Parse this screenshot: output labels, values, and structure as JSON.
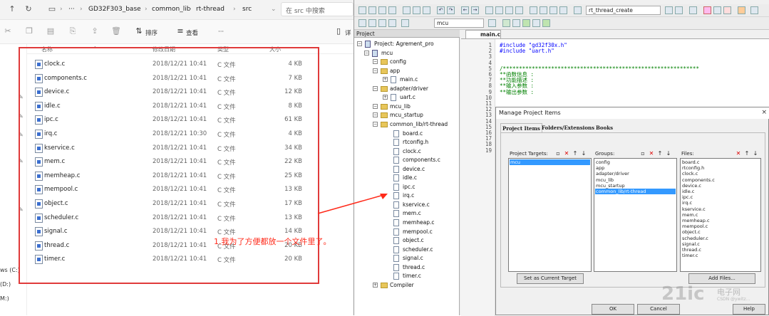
{
  "explorer": {
    "breadcrumbs": [
      "GD32F303_base",
      "common_lib",
      "rt-thread",
      "src"
    ],
    "search_placeholder": "在 src 中搜索",
    "commands": {
      "sort": "排序",
      "view": "查看",
      "more": "···",
      "details": "详"
    },
    "columns": {
      "name": "名称",
      "date": "修改日期",
      "type": "类型",
      "size": "大小"
    },
    "nav": {
      "drive_c": "ws (C:)",
      "drive_d": "(D:)",
      "drive_m": "M:)"
    },
    "files": [
      {
        "name": "clock.c",
        "date": "2018/12/21 10:41",
        "type": "C 文件",
        "size": "4 KB"
      },
      {
        "name": "components.c",
        "date": "2018/12/21 10:41",
        "type": "C 文件",
        "size": "7 KB"
      },
      {
        "name": "device.c",
        "date": "2018/12/21 10:41",
        "type": "C 文件",
        "size": "12 KB"
      },
      {
        "name": "idle.c",
        "date": "2018/12/21 10:41",
        "type": "C 文件",
        "size": "8 KB"
      },
      {
        "name": "ipc.c",
        "date": "2018/12/21 10:41",
        "type": "C 文件",
        "size": "61 KB"
      },
      {
        "name": "irq.c",
        "date": "2018/12/21 10:30",
        "type": "C 文件",
        "size": "4 KB"
      },
      {
        "name": "kservice.c",
        "date": "2018/12/21 10:41",
        "type": "C 文件",
        "size": "34 KB"
      },
      {
        "name": "mem.c",
        "date": "2018/12/21 10:41",
        "type": "C 文件",
        "size": "22 KB"
      },
      {
        "name": "memheap.c",
        "date": "2018/12/21 10:41",
        "type": "C 文件",
        "size": "25 KB"
      },
      {
        "name": "mempool.c",
        "date": "2018/12/21 10:41",
        "type": "C 文件",
        "size": "13 KB"
      },
      {
        "name": "object.c",
        "date": "2018/12/21 10:41",
        "type": "C 文件",
        "size": "17 KB"
      },
      {
        "name": "scheduler.c",
        "date": "2018/12/21 10:41",
        "type": "C 文件",
        "size": "13 KB"
      },
      {
        "name": "signal.c",
        "date": "2018/12/21 10:41",
        "type": "C 文件",
        "size": "14 KB"
      },
      {
        "name": "thread.c",
        "date": "2018/12/21 10:41",
        "type": "C 文件",
        "size": "20 KB"
      },
      {
        "name": "timer.c",
        "date": "2018/12/21 10:41",
        "type": "C 文件",
        "size": "20 KB"
      }
    ]
  },
  "annotation": "1.我为了方便都放一个文件里了。",
  "keil": {
    "target_select": "rt_thread_create",
    "target_name": "mcu",
    "project_title": "Project",
    "tree": [
      {
        "label": "Project: Agrement_pro",
        "kind": "root"
      },
      {
        "label": "mcu",
        "kind": "target"
      },
      {
        "label": "config",
        "kind": "group"
      },
      {
        "label": "app",
        "kind": "group"
      },
      {
        "label": "main.c",
        "kind": "file"
      },
      {
        "label": "adapter/driver",
        "kind": "group"
      },
      {
        "label": "uart.c",
        "kind": "file"
      },
      {
        "label": "mcu_lib",
        "kind": "group"
      },
      {
        "label": "mcu_startup",
        "kind": "group"
      },
      {
        "label": "common_lib/rt-thread",
        "kind": "group"
      },
      {
        "label": "board.c",
        "kind": "file"
      },
      {
        "label": "rtconfig.h",
        "kind": "file"
      },
      {
        "label": "clock.c",
        "kind": "file"
      },
      {
        "label": "components.c",
        "kind": "file"
      },
      {
        "label": "device.c",
        "kind": "file"
      },
      {
        "label": "idle.c",
        "kind": "file"
      },
      {
        "label": "ipc.c",
        "kind": "file"
      },
      {
        "label": "irq.c",
        "kind": "file"
      },
      {
        "label": "kservice.c",
        "kind": "file"
      },
      {
        "label": "mem.c",
        "kind": "file"
      },
      {
        "label": "memheap.c",
        "kind": "file"
      },
      {
        "label": "mempool.c",
        "kind": "file"
      },
      {
        "label": "object.c",
        "kind": "file"
      },
      {
        "label": "scheduler.c",
        "kind": "file"
      },
      {
        "label": "signal.c",
        "kind": "file"
      },
      {
        "label": "thread.c",
        "kind": "file"
      },
      {
        "label": "timer.c",
        "kind": "file"
      },
      {
        "label": "Compiler",
        "kind": "group"
      }
    ],
    "editor_tab": "main.c",
    "line_numbers": [
      "1",
      "2",
      "3",
      "4",
      "5",
      "6",
      "7",
      "8",
      "9",
      "10",
      "11",
      "12",
      "13",
      "14",
      "15",
      "16",
      "17",
      "18",
      "19"
    ],
    "code": [
      {
        "text": "#include \"gd32f30x.h\"",
        "color": "#0000ff"
      },
      {
        "text": "#include \"uart.h\"",
        "color": "#0000ff"
      },
      {
        "text": "",
        "color": "#000"
      },
      {
        "text": "",
        "color": "#000"
      },
      {
        "text": "/*************************************************************",
        "color": "#008000"
      },
      {
        "text": " **函数信息 :",
        "color": "#008000"
      },
      {
        "text": " **功能描述 :",
        "color": "#008000"
      },
      {
        "text": " **输入参数 :",
        "color": "#008000"
      },
      {
        "text": " **输出参数 :",
        "color": "#008000"
      }
    ]
  },
  "dialog": {
    "title": "Manage Project Items",
    "close": "×",
    "tabs": [
      "Project Items",
      "Folders/Extensions",
      "Books"
    ],
    "targets_label": "Project Targets:",
    "groups_label": "Groups:",
    "files_label": "Files:",
    "targets": [
      "mcu"
    ],
    "groups": [
      "config",
      "app",
      "adapter/driver",
      "mcu_lib",
      "mcu_startup",
      "common_lib/rt-thread"
    ],
    "files": [
      "board.c",
      "rtconfig.h",
      "clock.c",
      "components.c",
      "device.c",
      "idle.c",
      "ipc.c",
      "irq.c",
      "kservice.c",
      "mem.c",
      "memheap.c",
      "mempool.c",
      "object.c",
      "scheduler.c",
      "signal.c",
      "thread.c",
      "timer.c"
    ],
    "set_current_label": "Set as Current Target",
    "add_files_label": "Add Files...",
    "ok_label": "OK",
    "cancel_label": "Cancel",
    "help_label": "Help"
  },
  "watermark": {
    "logo": "21ic",
    "site": "电子网",
    "sub": "CSDN @ywitz..."
  }
}
